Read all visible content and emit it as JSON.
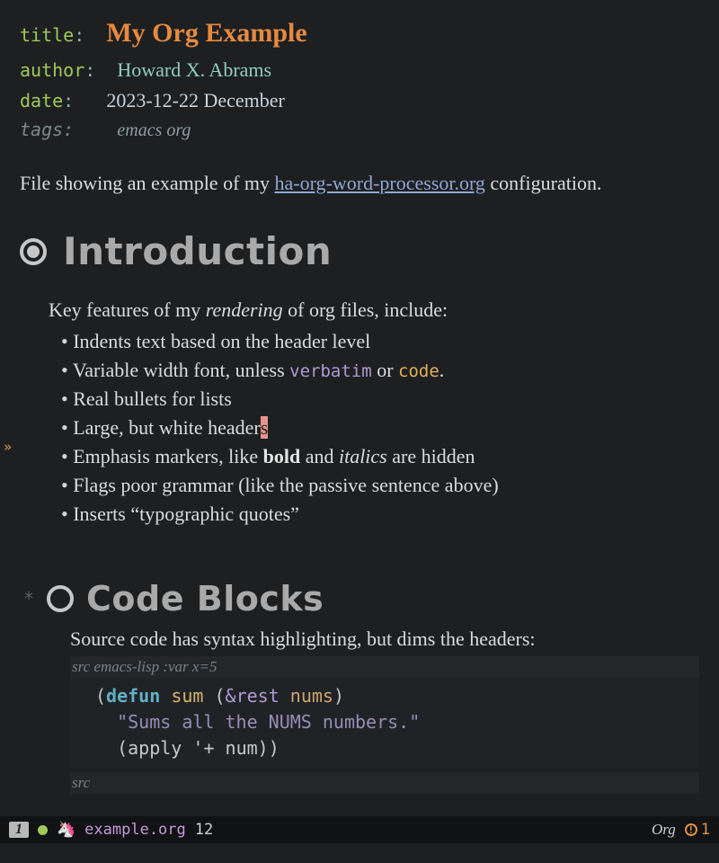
{
  "meta": {
    "title_key": "title",
    "title_val": "My Org Example",
    "author_key": "author",
    "author_val": "Howard X. Abrams",
    "date_key": "date",
    "date_val": "2023-12-22 December",
    "tags_key": "tags:",
    "tags_val": "emacs org"
  },
  "intro_para": {
    "pre": "File showing an example of my ",
    "link": "ha-org-word-processor.org",
    "post": " configuration."
  },
  "headings": {
    "h1": "Introduction",
    "h2": "Code Blocks"
  },
  "features_lead": {
    "pre": "Key features of my ",
    "em": "rendering",
    "post": " of org files, include:"
  },
  "bullets": {
    "b0": "Indents text based on the header level",
    "b1_pre": "Variable width font, unless ",
    "b1_verbatim": "verbatim",
    "b1_mid": " or ",
    "b1_code": "code",
    "b1_post": ".",
    "b2": "Real bullets for lists",
    "b3_pre": "Large, but white header",
    "b3_cursor": "s",
    "b4_pre": "Emphasis markers, like ",
    "b4_bold": "bold",
    "b4_mid": " and ",
    "b4_italic": "italics",
    "b4_post": " are hidden",
    "b5": "Flags poor grammar (like the passive sentence above)",
    "b6": "Inserts “typographic quotes”"
  },
  "code_section": {
    "lead": "Source code has syntax highlighting, but dims the headers:",
    "src_header": "src emacs-lisp :var x=5",
    "line1_kw": "defun",
    "line1_fn": "sum",
    "line1_amp": "&rest",
    "line1_arg": "nums",
    "line2_str": "\"Sums all the NUMS numbers.\"",
    "line3_apply": "apply",
    "line3_quote": "'+",
    "line3_arg": "num",
    "src_footer": "src"
  },
  "modeline": {
    "winnum": "1",
    "file": "example.org",
    "line": "12",
    "mode": "Org",
    "warn_count": "1"
  }
}
